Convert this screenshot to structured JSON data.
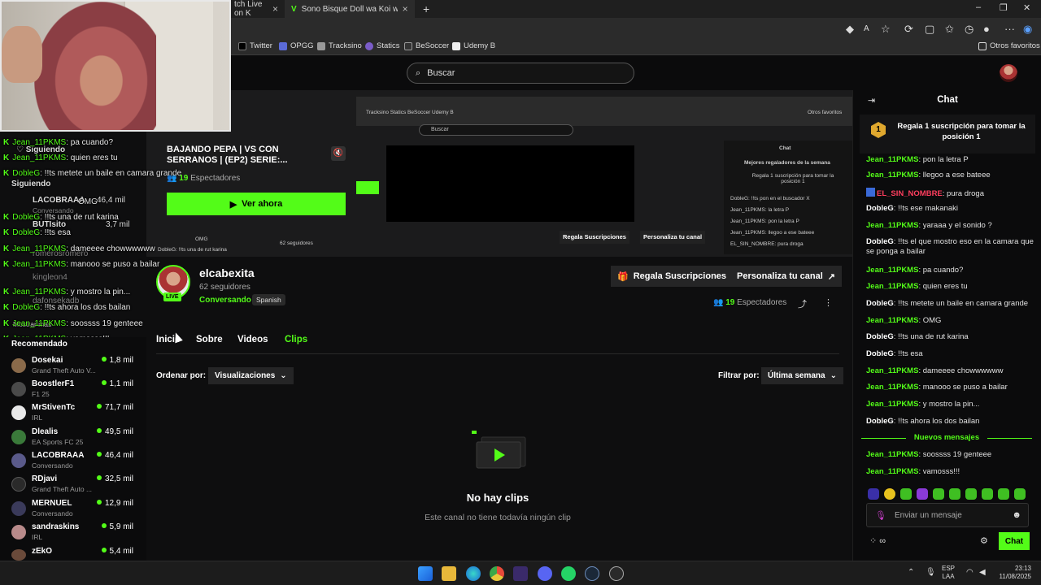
{
  "browser": {
    "tabs": [
      {
        "label": "tch Live on K"
      },
      {
        "label": "Sono Bisque Doll wa Koi wo Suru"
      }
    ],
    "new_tab": "+",
    "bookmarks": [
      "Twitter",
      "OPGG",
      "Tracksino",
      "Statics",
      "BeSoccer",
      "Udemy B"
    ],
    "other_favorites": "Otros favoritos"
  },
  "header": {
    "search_placeholder": "Buscar"
  },
  "overlay": {
    "following_label": "Siguiendo",
    "following_label_2": "Siguiendo",
    "messages": [
      {
        "user": "Jean_11PKMS",
        "text": ": pa cuando?"
      },
      {
        "user": "Jean_11PKMS",
        "text": ": quien eres tu"
      },
      {
        "user": "DobleG",
        "text": ": !!ts metete un baile en camara grande"
      },
      {
        "user": "DobleG",
        "text": ": !!ts una de rut karina"
      },
      {
        "user": "DobleG",
        "text": ": !!ts esa"
      },
      {
        "user": "Jean_11PKMS",
        "text": ": dameeee chowwwwww"
      },
      {
        "user": "Jean_11PKMS",
        "text": ": manooo se puso a bailar"
      },
      {
        "user": "Jean_11PKMS",
        "text": ": y mostro la pin..."
      },
      {
        "user": "DobleG",
        "text": ": !!ts ahora los dos bailan"
      },
      {
        "user": "Jean_11PKMS",
        "text": ": soossss 19 genteee"
      },
      {
        "user": "Jean_11PKMS",
        "text": ": vamosss!!!"
      }
    ],
    "ghosts": {
      "lacobraaa": "LACOBRAAA",
      "lacobraaa_views": "46,4 mil",
      "conversando": "Conversando",
      "omg": "OMG",
      "butisito": "BUTIsito",
      "butisito_views": "3,7 mil",
      "romero": "romerosromero",
      "kingleon": "kingleon4",
      "dafonsekadb": "dafonsekadb",
      "mostrar": "Mostrar más"
    }
  },
  "sidebar": {
    "title": "Recomendado",
    "items": [
      {
        "name": "Dosekai",
        "category": "Grand Theft Auto V...",
        "viewers": "1,8 mil",
        "color": "#8a6a4a"
      },
      {
        "name": "BoostlerF1",
        "category": "F1 25",
        "viewers": "1,1 mil",
        "color": "#4a4a4a"
      },
      {
        "name": "MrStivenTc",
        "category": "IRL",
        "viewers": "71,7 mil",
        "color": "#e8e8e8"
      },
      {
        "name": "Dlealis",
        "category": "EA Sports FC 25",
        "viewers": "49,5 mil",
        "color": "#3a7a3a"
      },
      {
        "name": "LACOBRAAA",
        "category": "Conversando",
        "viewers": "46,4 mil",
        "color": "#5a5a8a"
      },
      {
        "name": "RDjavi",
        "category": "Grand Theft Auto ...",
        "viewers": "32,5 mil",
        "color": "#2a2a2a"
      },
      {
        "name": "MERNUEL",
        "category": "Conversando",
        "viewers": "12,9 mil",
        "color": "#3a3a5a"
      },
      {
        "name": "sandraskins",
        "category": "IRL",
        "viewers": "5,9 mil",
        "color": "#b88a8a"
      },
      {
        "name": "zEkO",
        "category": "",
        "viewers": "5,4 mil",
        "color": "#6a4a3a"
      }
    ]
  },
  "player": {
    "offline_title": "BAJANDO PEPA | VS CON SERRANOS | (EP2) SERIE:...",
    "viewers_count": "19",
    "viewers_label": "Espectadores",
    "watch_button": "Ver ahora",
    "mini": {
      "search": "Buscar",
      "chat": "Chat",
      "top_gifters": "Mejores regaladores de la semana",
      "gift_line": "Regala 1 suscripción para tomar la posición 1",
      "line1": "DobleG: !!ts pon en el buscador X",
      "line2": "Jean_11PKMS: la letra P",
      "line3": "Jean_11PKMS: pon la letra P",
      "line4": "Jean_11PKMS: llegoo a ese bateee",
      "line5": "EL_SIN_NOMBRE: pura droga",
      "gift_btn": "Regala Suscripciones",
      "customize_btn": "Personaliza tu canal",
      "followers": "62 seguidores",
      "omg": "OMG",
      "bottom": "DobleG: !!ts una de rut karina",
      "bookmarks": "Tracksino   Statics   BeSoccer   Udemy B",
      "other": "Otros favoritos"
    }
  },
  "channel": {
    "name": "elcabexita",
    "followers": "62 seguidores",
    "category": "Conversando",
    "language": "Spanish",
    "live": "LIVE",
    "gift_button": "Regala Suscripciones",
    "customize_button": "Personaliza tu canal",
    "viewers_count": "19",
    "viewers_label": "Espectadores"
  },
  "tabs": [
    "Inicio",
    "Sobre",
    "Videos",
    "Clips"
  ],
  "clips": {
    "sort_label": "Ordenar por:",
    "sort_value": "Visualizaciones",
    "filter_label": "Filtrar por:",
    "filter_value": "Última semana",
    "empty_title": "No hay clips",
    "empty_subtitle": "Este canal no tiene todavía ningún clip"
  },
  "chat": {
    "title": "Chat",
    "pinned_rank": "1",
    "pinned_text": "Regala 1 suscripción para tomar la posición 1",
    "messages": [
      {
        "user": "Jean_11PKMS",
        "text": ": pon la letra P",
        "color": "green"
      },
      {
        "user": "Jean_11PKMS",
        "text": ": llegoo a ese bateee",
        "color": "green"
      },
      {
        "user": "EL_SIN_NOMBRE",
        "text": ": pura droga",
        "color": "red"
      },
      {
        "user": "DobleG",
        "text": ": !!ts ese makanaki",
        "color": "white"
      },
      {
        "user": "Jean_11PKMS",
        "text": ": yaraaa y el sonido ?",
        "color": "green"
      },
      {
        "user": "DobleG",
        "text": ": !!ts el que mostro eso en la camara que se ponga a bailar",
        "color": "white"
      },
      {
        "user": "Jean_11PKMS",
        "text": ": pa cuando?",
        "color": "green"
      },
      {
        "user": "Jean_11PKMS",
        "text": ": quien eres tu",
        "color": "green"
      },
      {
        "user": "DobleG",
        "text": ": !!ts metete un baile en camara grande",
        "color": "white"
      },
      {
        "user": "Jean_11PKMS",
        "text": ": OMG",
        "color": "green"
      },
      {
        "user": "DobleG",
        "text": ": !!ts una de rut karina",
        "color": "white"
      },
      {
        "user": "DobleG",
        "text": ": !!ts esa",
        "color": "white"
      },
      {
        "user": "Jean_11PKMS",
        "text": ": dameeee chowwwwww",
        "color": "green"
      },
      {
        "user": "Jean_11PKMS",
        "text": ": manooo se puso a bailar",
        "color": "green"
      },
      {
        "user": "Jean_11PKMS",
        "text": ": y mostro la pin...",
        "color": "green"
      },
      {
        "user": "DobleG",
        "text": ": !!ts ahora los dos bailan",
        "color": "white"
      }
    ],
    "new_messages_label": "Nuevos mensajes",
    "new_messages": [
      {
        "user": "Jean_11PKMS",
        "text": ": soossss 19 genteee",
        "color": "green"
      },
      {
        "user": "Jean_11PKMS",
        "text": ": vamosss!!!",
        "color": "green"
      }
    ],
    "input_placeholder": "Enviar un mensaje",
    "send_button": "Chat"
  },
  "taskbar": {
    "lang_1": "ESP",
    "lang_2": "LAA",
    "time": "23:13",
    "date": "11/08/2025"
  },
  "colors": {
    "accent": "#53fc18",
    "background": "#0e0e0f",
    "red_user": "#ff3e5e"
  }
}
